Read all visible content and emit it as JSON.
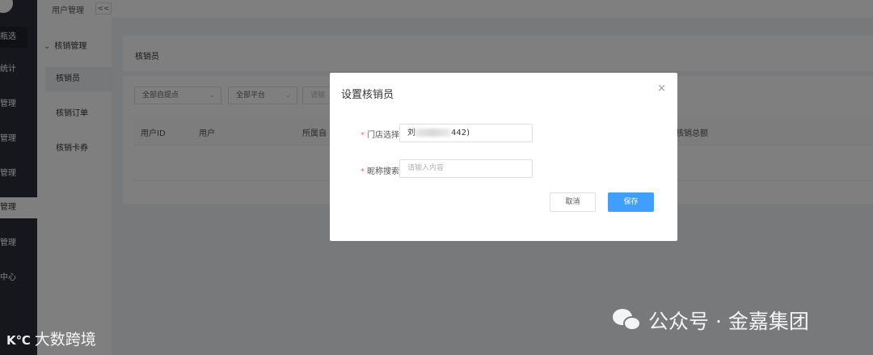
{
  "sidebar": {
    "items": [
      {
        "label": "瓶选",
        "state": "active-a"
      },
      {
        "label": "统计"
      },
      {
        "label": "管理"
      },
      {
        "label": "管理"
      },
      {
        "label": "管理"
      },
      {
        "label": "管理",
        "state": "active-b"
      },
      {
        "label": "管理"
      },
      {
        "label": "中心"
      }
    ]
  },
  "breadcrumb": {
    "text": "用户管理",
    "collapse": "<<"
  },
  "submenu": {
    "group": "核销管理",
    "items": [
      {
        "label": "核销员",
        "active": true
      },
      {
        "label": "核销订单"
      },
      {
        "label": "核销卡券"
      }
    ]
  },
  "page": {
    "title": "核销员",
    "filters": [
      {
        "label": "全部自提点"
      },
      {
        "label": "全部平台"
      },
      {
        "label": "请输"
      }
    ],
    "table_headers": [
      "用户ID",
      "用户",
      "所属自",
      "核销总额"
    ]
  },
  "modal": {
    "title": "设置核销员",
    "close": "×",
    "store_label": "门店选择",
    "store_value_prefix": "刘",
    "store_value_suffix": "442)",
    "nickname_label": "昵称搜索",
    "nickname_placeholder": "请输入内容",
    "cancel": "取消",
    "save": "保存"
  },
  "watermark": {
    "left_mark": "Κ℃",
    "left_text": "大数跨境",
    "right_text": "公众号 · 金嘉集团"
  }
}
